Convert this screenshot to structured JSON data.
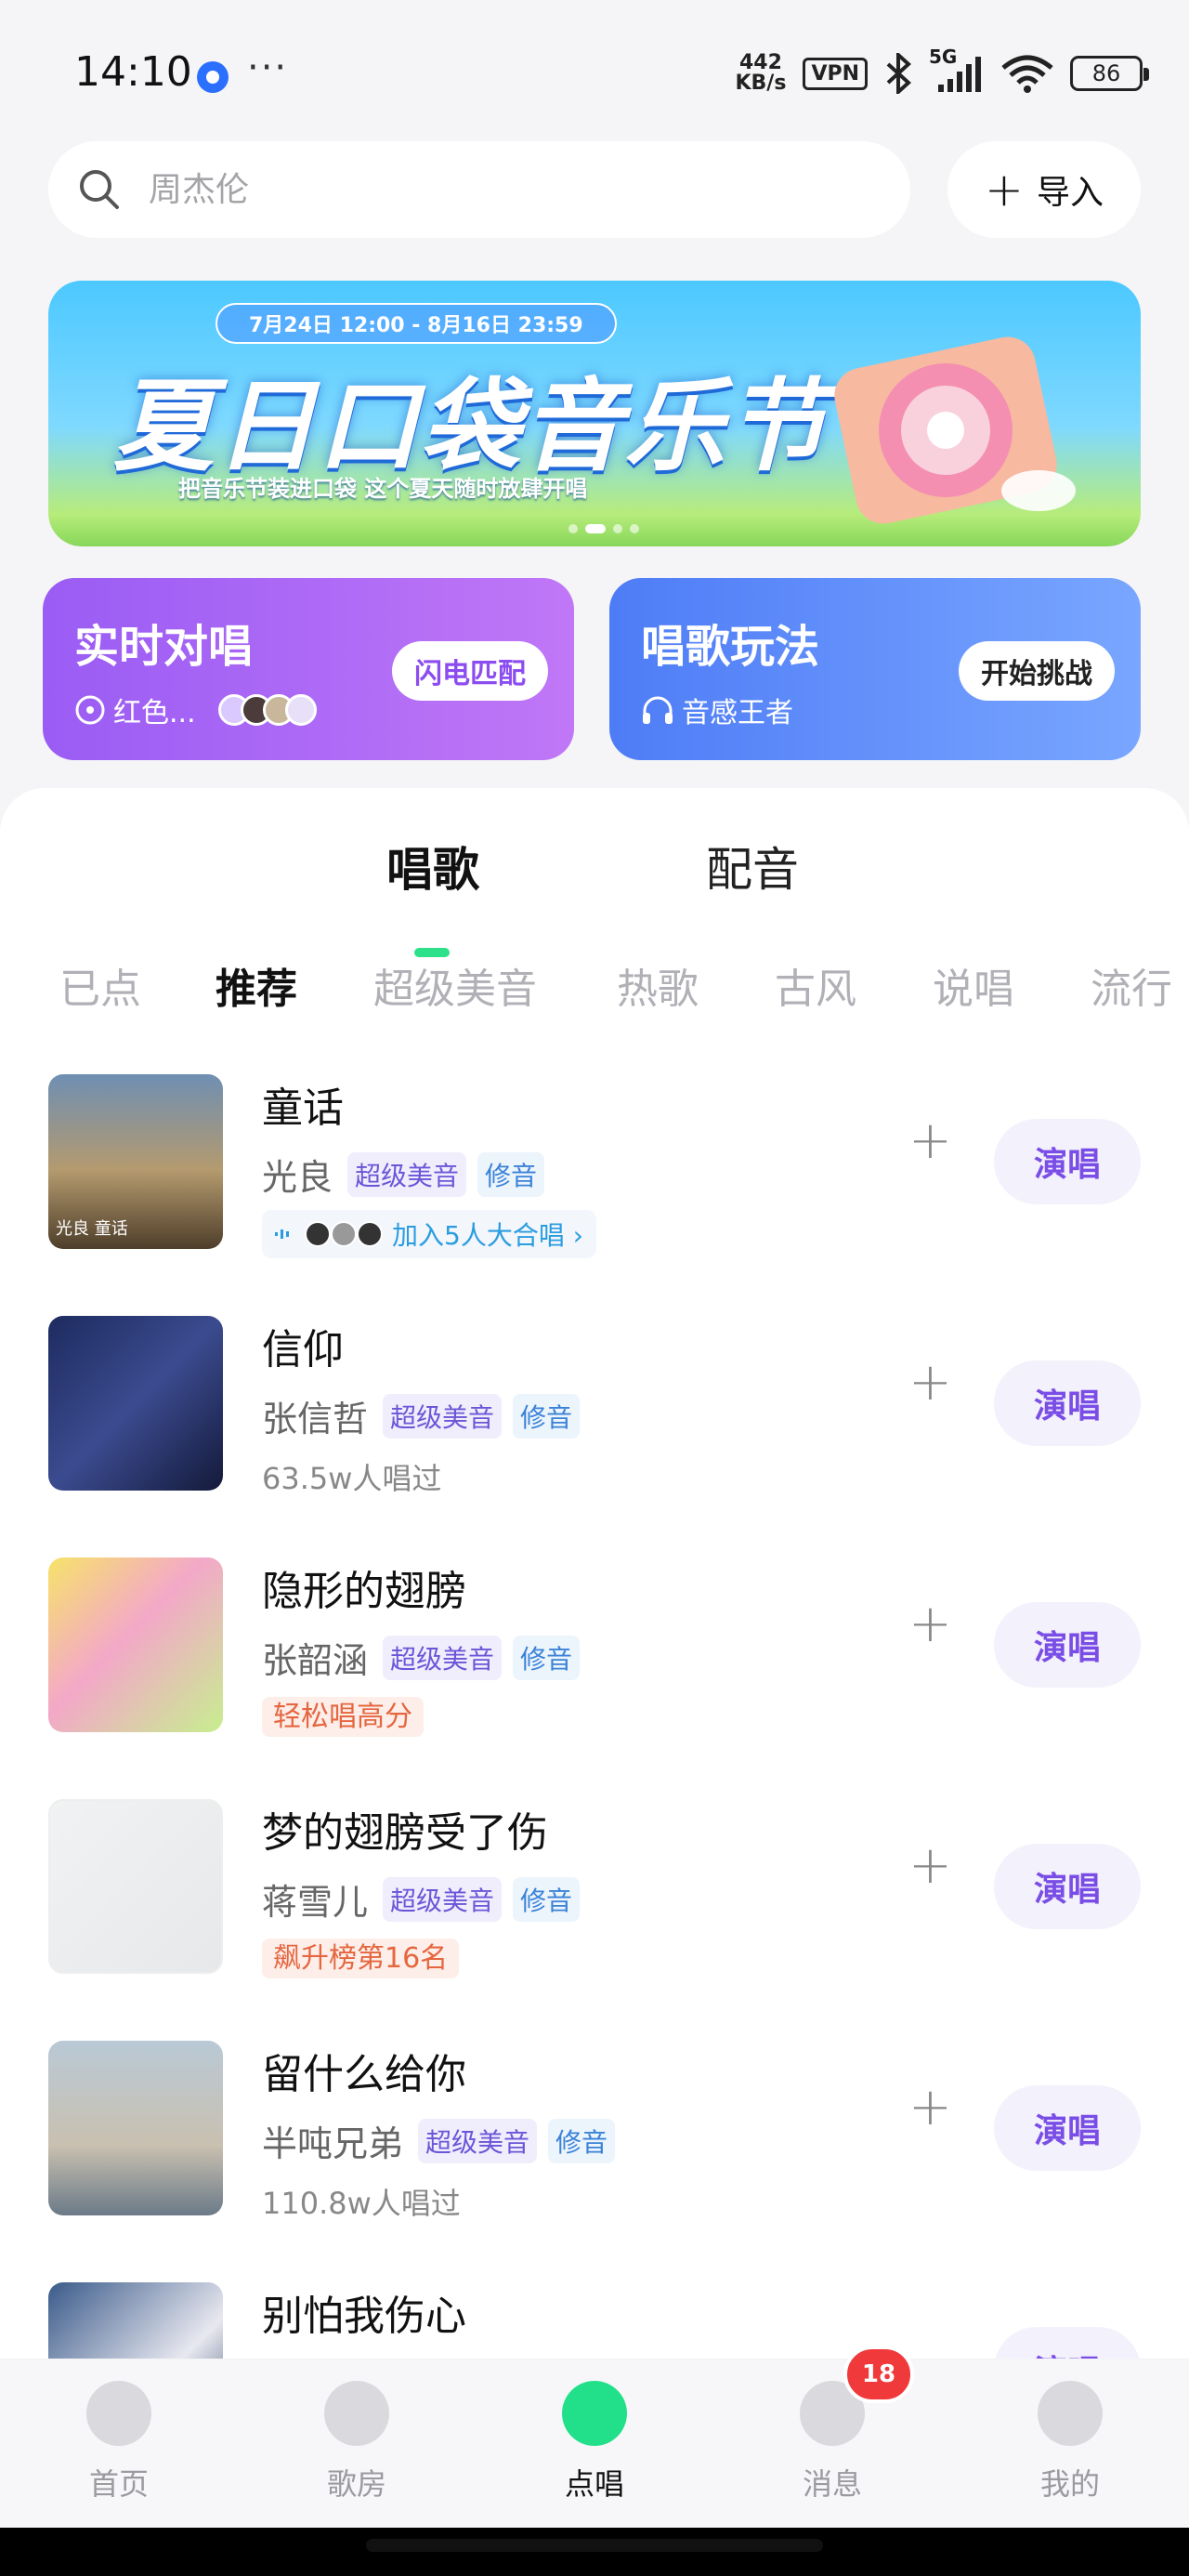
{
  "status": {
    "time": "14:10",
    "net_speed_value": "442",
    "net_speed_unit": "KB/s",
    "vpn": "VPN",
    "network": "5G",
    "battery": "86",
    "more": "···"
  },
  "search": {
    "placeholder": "周杰伦",
    "import_label": "导入"
  },
  "banner": {
    "date_range": "7月24日 12:00 - 8月16日 23:59",
    "title": "夏日口袋音乐节",
    "subtitle": "把音乐节装进口袋 这个夏天随时放肆开唱"
  },
  "features": {
    "duet": {
      "title": "实时对唱",
      "sub": "红色...",
      "button": "闪电匹配"
    },
    "play": {
      "title": "唱歌玩法",
      "sub": "音感王者",
      "button": "开始挑战"
    }
  },
  "main_tabs": [
    "唱歌",
    "配音"
  ],
  "sub_tabs": [
    "已点",
    "推荐",
    "超级美音",
    "热歌",
    "古风",
    "说唱",
    "流行"
  ],
  "songs": [
    {
      "title": "童话",
      "artist": "光良",
      "tags": [
        "超级美音",
        "修音"
      ],
      "extra": "加入5人大合唱 ›",
      "extra_type": "chorus"
    },
    {
      "title": "信仰",
      "artist": "张信哲",
      "tags": [
        "超级美音",
        "修音"
      ],
      "extra": "63.5w人唱过",
      "extra_type": "count"
    },
    {
      "title": "隐形的翅膀",
      "artist": "张韶涵",
      "tags": [
        "超级美音",
        "修音"
      ],
      "extra": "轻松唱高分",
      "extra_type": "hot"
    },
    {
      "title": "梦的翅膀受了伤",
      "artist": "蒋雪儿",
      "tags": [
        "超级美音",
        "修音"
      ],
      "extra": "飙升榜第16名",
      "extra_type": "hot"
    },
    {
      "title": "留什么给你",
      "artist": "半吨兄弟",
      "tags": [
        "超级美音",
        "修音"
      ],
      "extra": "110.8w人唱过",
      "extra_type": "count"
    },
    {
      "title": "别怕我伤心",
      "artist": "",
      "tags": [],
      "extra": "",
      "extra_type": ""
    }
  ],
  "sing_label": "演唱",
  "cover_texts": {
    "song1": "光良 童话"
  },
  "nav": [
    {
      "label": "首页",
      "icon": "home-icon"
    },
    {
      "label": "歌房",
      "icon": "music-note-icon"
    },
    {
      "label": "点唱",
      "icon": "mic-icon"
    },
    {
      "label": "消息",
      "icon": "message-icon"
    },
    {
      "label": "我的",
      "icon": "profile-icon"
    }
  ],
  "nav_badge": "18",
  "colors": {
    "accent_green": "#22e08a",
    "sing_purple": "#7a4ee6",
    "badge_red": "#f0393b"
  }
}
